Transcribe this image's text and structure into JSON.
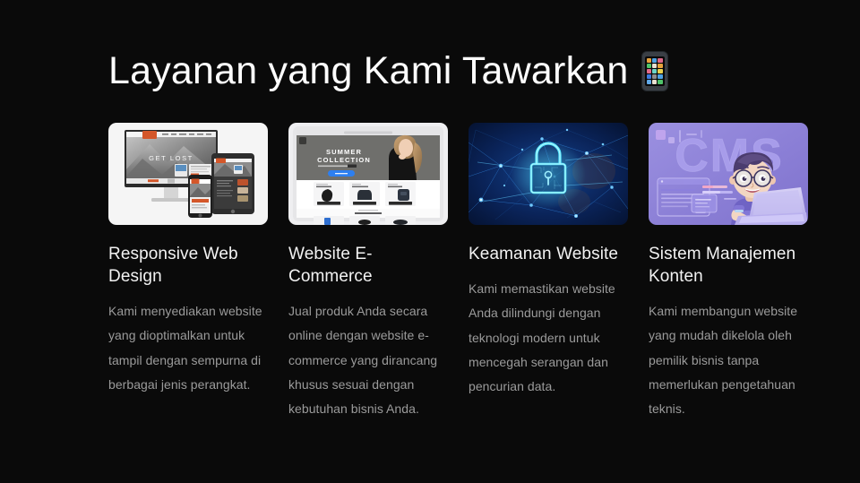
{
  "page": {
    "background_color": "#0a0a0a",
    "title": "Layanan yang Kami Tawarkan",
    "title_emoji_name": "mobile-phone-emoji",
    "title_color": "#fdfdfd",
    "heading_color": "#f2f2f2",
    "body_color": "#9b9b9b"
  },
  "cards": [
    {
      "id": "responsive-web-design",
      "title": "Responsive Web Design",
      "description": "Kami menyediakan website yang dioptimalkan untuk tampil dengan sempurna di berbagai jenis perangkat.",
      "image_name": "responsive-devices-mockup-image",
      "image_alt": "Desktop monitor, tablet and smartphone showing a grayscale mountain website with GET LOST headline and orange accents",
      "image_colors": {
        "background": "#f4f4f4",
        "accent": "#d4572a",
        "screen_dark": "#3a3a3a"
      },
      "image_text": "GET LOST"
    },
    {
      "id": "website-e-commerce",
      "title": "Website E-Commerce",
      "description": "Jual produk Anda secara online dengan website e-commerce yang dirancang khusus sesuai dengan kebutuhan bisnis Anda.",
      "image_name": "ecommerce-store-mockup-image",
      "image_alt": "Laptop browser showing an online fashion store with a model and Summer Collection hero banner plus product cards",
      "image_colors": {
        "background": "#ffffff",
        "hero": "#6b6b68",
        "accent": "#2d7ff0"
      },
      "image_text": "SUMMER COLLECTION"
    },
    {
      "id": "keamanan-website",
      "title": "Keamanan Website",
      "description": "Kami memastikan website Anda dilindungi dengan teknologi modern untuk mencegah serangan dan pencurian data.",
      "image_name": "cyber-security-padlock-image",
      "image_alt": "Glowing cyan digital padlock over a dark blue network of connected nodes and lines",
      "image_colors": {
        "background": "#071a3d",
        "accent": "#22d3ff",
        "glow": "#4aa8ff"
      },
      "image_text": ""
    },
    {
      "id": "sistem-manajemen-konten",
      "title": "Sistem Manajemen Konten",
      "description": "Kami membangun website yang mudah dikelola oleh pemilik bisnis tanpa memerlukan pengetahuan teknis.",
      "image_name": "cms-illustration-image",
      "image_alt": "Purple 3D cartoon character with glasses typing on a laptop with large CMS lettering in the background",
      "image_colors": {
        "background": "#8b80d6",
        "accent": "#b7aef0",
        "skin": "#f3d9c6"
      },
      "image_text": "CMS"
    }
  ]
}
